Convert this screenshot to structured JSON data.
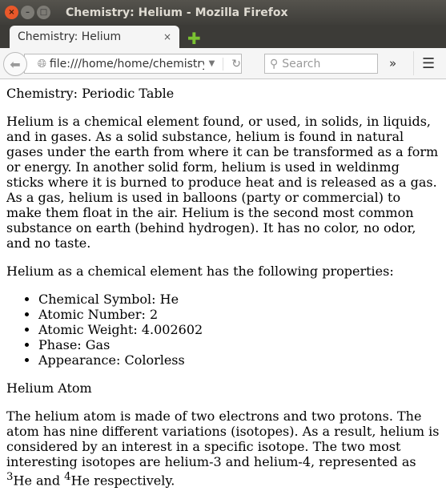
{
  "window": {
    "title": "Chemistry: Helium - Mozilla Firefox"
  },
  "tab": {
    "label": "Chemistry: Helium",
    "close": "×",
    "new_tab": "✚"
  },
  "nav": {
    "url": "file:///home/home/chemistry/h",
    "search_placeholder": "Search",
    "overflow": "»",
    "menu": "☰"
  },
  "page": {
    "heading1": "Chemistry: Periodic Table",
    "para1": "Helium is a chemical element found, or used, in solids, in liquids, and in gases. As a solid substance, helium is found in natural gases under the earth from where it can be transformed as a form or energy. In another solid form, helium is used in weldinmg sticks where it is burned to produce heat and is released as a gas. As a gas, helium is used in balloons (party or commercial) to make them float in the air. Helium is the second most common substance on earth (behind hydrogen). It has no color, no odor, and no taste.",
    "para2": "Helium as a chemical element has the following properties:",
    "properties": [
      "Chemical Symbol: He",
      "Atomic Number: 2",
      "Atomic Weight: 4.002602",
      "Phase: Gas",
      "Appearance: Colorless"
    ],
    "heading2": "Helium Atom",
    "para3_a": "The helium atom is made of two electrons and two protons. The atom has nine different variations (isotopes). As a result, helium is considered by an interest in a specific isotope. The two most interesting isotopes are helium-3 and helium-4, represented as ",
    "sup1": "3",
    "para3_b": "He and ",
    "sup2": "4",
    "para3_c": "He respectively."
  }
}
